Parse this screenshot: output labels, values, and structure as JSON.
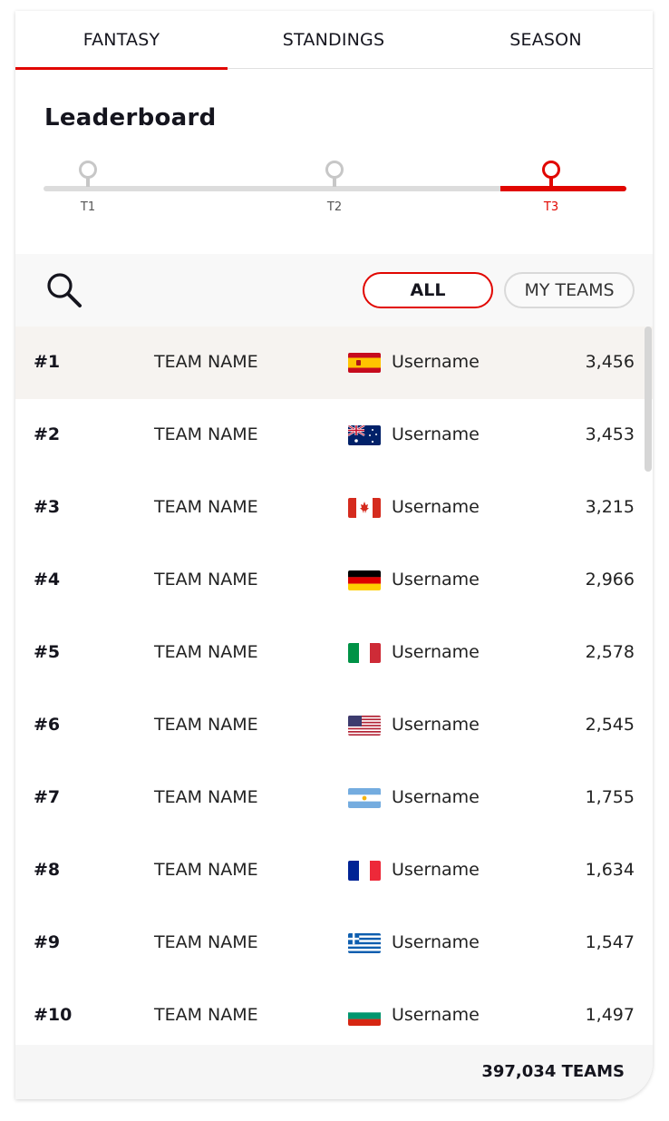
{
  "tabs": [
    {
      "label": "FANTASY",
      "active": true
    },
    {
      "label": "STANDINGS",
      "active": false
    },
    {
      "label": "SEASON",
      "active": false
    }
  ],
  "leaderboard": {
    "title": "Leaderboard",
    "stages": [
      {
        "label": "T1",
        "active": false
      },
      {
        "label": "T2",
        "active": false
      },
      {
        "label": "T3",
        "active": true
      }
    ]
  },
  "filters": {
    "all_label": "ALL",
    "my_teams_label": "MY TEAMS",
    "search_icon": "search-icon"
  },
  "rows": [
    {
      "rank": "#1",
      "team": "TEAM NAME",
      "flag": "spain",
      "user": "Username",
      "points": "3,456",
      "highlight": true
    },
    {
      "rank": "#2",
      "team": "TEAM NAME",
      "flag": "australia",
      "user": "Username",
      "points": "3,453"
    },
    {
      "rank": "#3",
      "team": "TEAM NAME",
      "flag": "canada",
      "user": "Username",
      "points": "3,215"
    },
    {
      "rank": "#4",
      "team": "TEAM NAME",
      "flag": "germany",
      "user": "Username",
      "points": "2,966"
    },
    {
      "rank": "#5",
      "team": "TEAM NAME",
      "flag": "italy",
      "user": "Username",
      "points": "2,578"
    },
    {
      "rank": "#6",
      "team": "TEAM NAME",
      "flag": "usa",
      "user": "Username",
      "points": "2,545"
    },
    {
      "rank": "#7",
      "team": "TEAM NAME",
      "flag": "argentina",
      "user": "Username",
      "points": "1,755"
    },
    {
      "rank": "#8",
      "team": "TEAM NAME",
      "flag": "france",
      "user": "Username",
      "points": "1,634"
    },
    {
      "rank": "#9",
      "team": "TEAM NAME",
      "flag": "greece",
      "user": "Username",
      "points": "1,547"
    },
    {
      "rank": "#10",
      "team": "TEAM NAME",
      "flag": "bulgaria",
      "user": "Username",
      "points": "1,497"
    }
  ],
  "footer": {
    "total": "397,034 TEAMS"
  },
  "colors": {
    "accent": "#e10600",
    "text": "#15151e",
    "highlight_row": "#f6f3f0"
  }
}
